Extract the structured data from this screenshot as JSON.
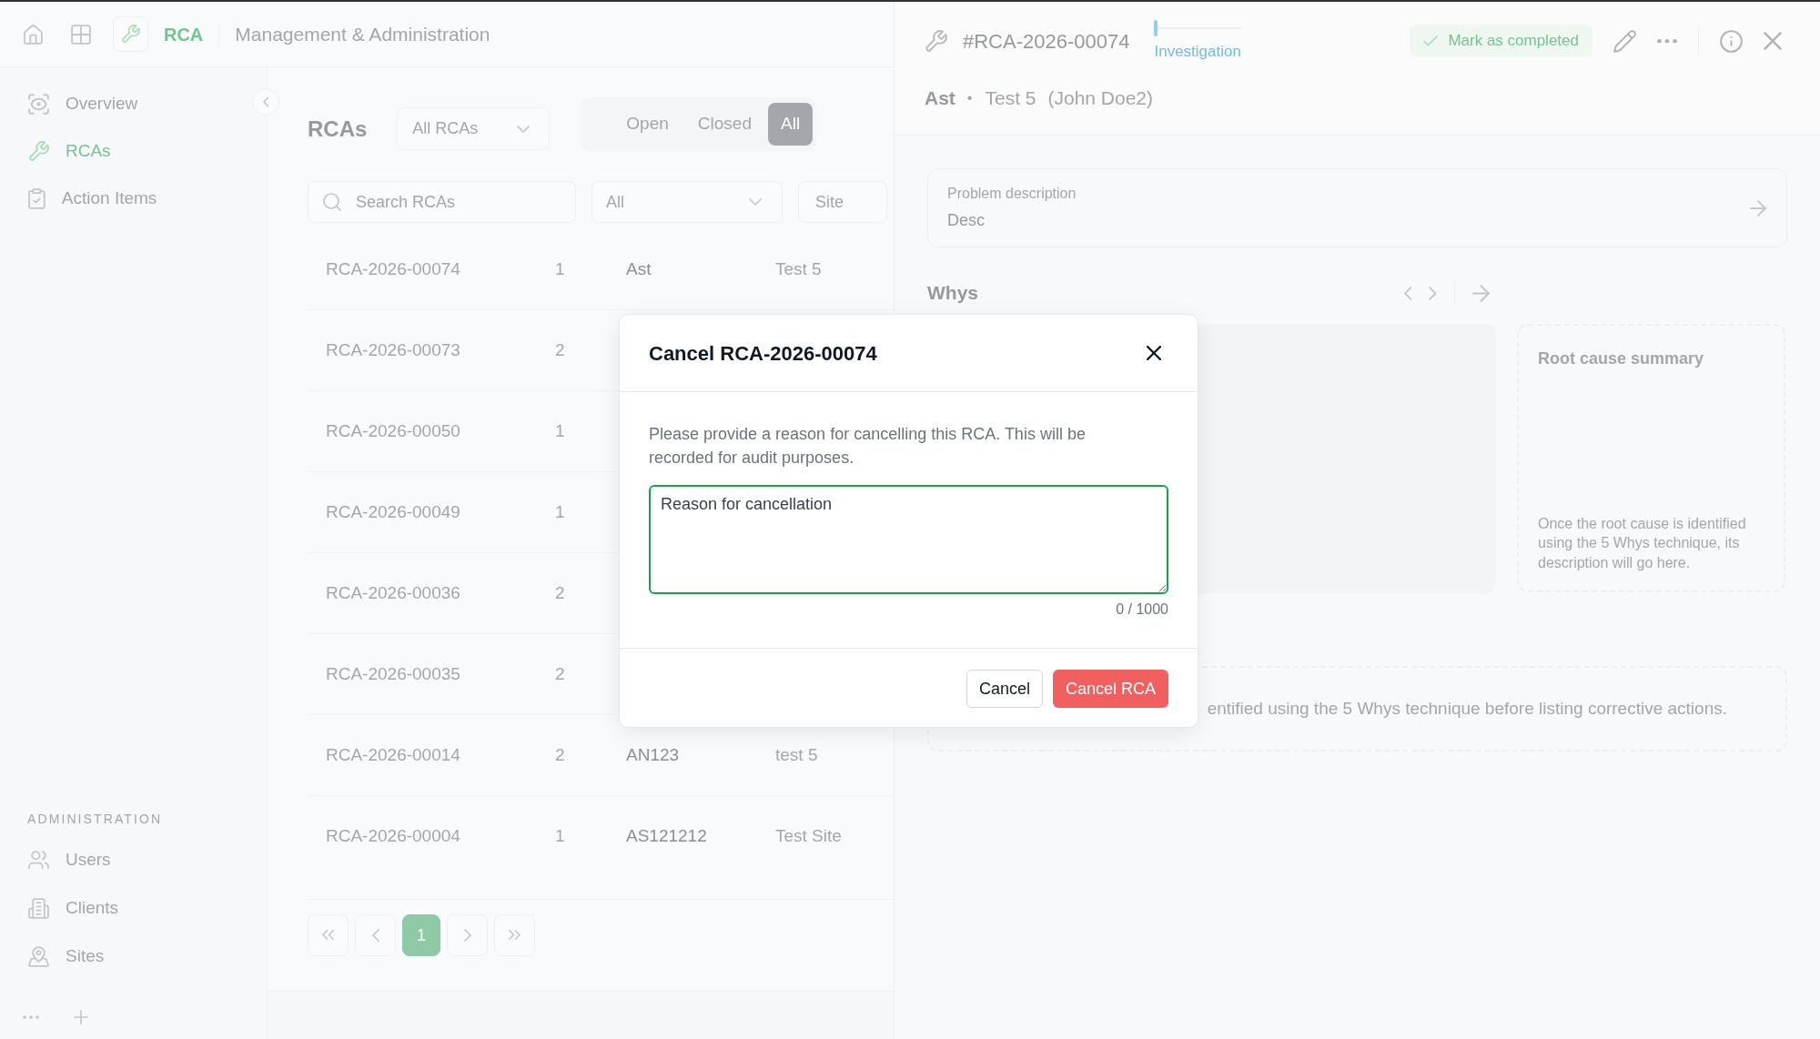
{
  "top_bar": {
    "app_name": "RCA",
    "section": "Management & Administration"
  },
  "sidebar": {
    "items": [
      {
        "label": "Overview",
        "selected": false
      },
      {
        "label": "RCAs",
        "selected": true
      },
      {
        "label": "Action Items",
        "selected": false
      }
    ],
    "admin_heading": "ADMINISTRATION",
    "admin_items": [
      {
        "label": "Users",
        "selected": false
      },
      {
        "label": "Clients",
        "selected": false
      },
      {
        "label": "Sites",
        "selected": false
      }
    ]
  },
  "rca_list": {
    "title": "RCAs",
    "scope_dropdown": {
      "value": "All RCAs"
    },
    "status_tabs": [
      {
        "label": "Open",
        "selected": false
      },
      {
        "label": "Closed",
        "selected": false
      },
      {
        "label": "All",
        "selected": true
      }
    ],
    "search": {
      "placeholder": "Search RCAs"
    },
    "status_filter": {
      "value": "All"
    },
    "site_filter": {
      "placeholder": "Site"
    },
    "rows": [
      {
        "id": "RCA-2026-00074",
        "column_2": "1",
        "column_3": "Ast",
        "column_4": "Test 5"
      },
      {
        "id": "RCA-2026-00073",
        "column_2": "2"
      },
      {
        "id": "RCA-2026-00050",
        "column_2": "1"
      },
      {
        "id": "RCA-2026-00049",
        "column_2": "1"
      },
      {
        "id": "RCA-2026-00036",
        "column_2": "2"
      },
      {
        "id": "RCA-2026-00035",
        "column_2": "2"
      },
      {
        "id": "RCA-2026-00014",
        "column_2": "2",
        "column_3": "AN123",
        "column_4": "test 5"
      },
      {
        "id": "RCA-2026-00004",
        "column_2": "1",
        "column_3": "AS121212",
        "column_4": "Test Site"
      }
    ],
    "pagination": {
      "pages": [
        {
          "label": "1",
          "selected": true
        }
      ]
    }
  },
  "detail": {
    "id": "#RCA-2026-00074",
    "stage": {
      "label": "Investigation",
      "level": 0.04
    },
    "complete_button": {
      "label": "Mark as completed"
    },
    "title": "Ast",
    "separator": "•",
    "subtitle": "Test 5",
    "person": "(John Doe2)",
    "problem": {
      "label": "Problem description",
      "value": "Desc"
    },
    "whys": {
      "title": "Whys"
    },
    "root_cause": {
      "title": "Root cause summary",
      "text": "Once the root cause is identified using the 5 Whys technique, its description will go here."
    },
    "corrective_actions": {
      "text": "entified using the 5 Whys technique before listing corrective actions."
    }
  },
  "modal": {
    "title": "Cancel RCA-2026-00074",
    "message": "Please provide a reason for cancelling this RCA. This will be recorded for audit purposes.",
    "reason_field": {
      "placeholder": "Reason for cancellation",
      "focused": true,
      "counter": "0 / 1000"
    },
    "buttons": [
      {
        "label": "Cancel",
        "kind": "secondary"
      },
      {
        "label": "Cancel RCA",
        "kind": "danger"
      }
    ]
  }
}
